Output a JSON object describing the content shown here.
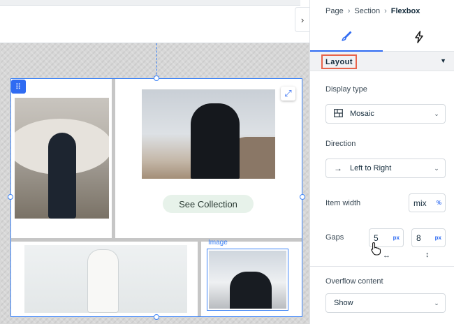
{
  "breadcrumb": {
    "page": "Page",
    "section": "Section",
    "current": "Flexbox",
    "separator": "›"
  },
  "tabs": {
    "design_icon": "paintbrush-icon",
    "interactions_icon": "lightning-icon"
  },
  "layout": {
    "title": "Layout",
    "caret": "▼"
  },
  "display_type": {
    "label": "Display type",
    "value": "Mosaic",
    "icon": "mosaic-grid-icon"
  },
  "direction": {
    "label": "Direction",
    "value": "Left to Right",
    "icon": "arrow-right-icon"
  },
  "item_width": {
    "label": "Item width",
    "value": "mix",
    "unit": "%"
  },
  "gaps": {
    "label": "Gaps",
    "horizontal": "5",
    "vertical": "8",
    "unit": "px",
    "h_icon": "↔",
    "v_icon": "↕"
  },
  "overflow": {
    "label": "Overflow content",
    "value": "Show"
  },
  "canvas": {
    "button_label": "See Collection",
    "image_tag": "Image",
    "collapse_glyph": "›",
    "expand_glyph": "⤢",
    "move_glyph": "⠿"
  },
  "colors": {
    "accent": "#2f6bf2",
    "highlight": "#e8634a",
    "button_bg": "#e7f2ea"
  }
}
